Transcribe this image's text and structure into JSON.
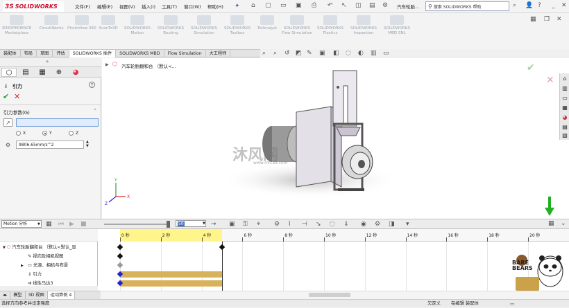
{
  "app": {
    "brand": "SOLIDWORKS",
    "brand_prefix": "3S"
  },
  "menu": [
    "文件(F)",
    "编辑(E)",
    "视图(V)",
    "插入(I)",
    "工具(T)",
    "窗口(W)",
    "帮助(H)"
  ],
  "document_title": "汽车轮胎...",
  "help_search": {
    "placeholder": "搜索 SOLIDWORKS 帮助"
  },
  "command_manager": [
    {
      "label": "3DEXPERIENCE Marketplace"
    },
    {
      "label": "CircuitWorks"
    },
    {
      "label": "PhotoView 360"
    },
    {
      "label": "ScanTo3D"
    },
    {
      "label": "SOLIDWORKS Motion"
    },
    {
      "label": "SOLIDWORKS Routing"
    },
    {
      "label": "SOLIDWORKS Simulation"
    },
    {
      "label": "SOLIDWORKS Toolbox"
    },
    {
      "label": "TolAnalyst"
    },
    {
      "label": "SOLIDWORKS Flow Simulation"
    },
    {
      "label": "SOLIDWORKS Plastics"
    },
    {
      "label": "SOLIDWORKS Inspection"
    },
    {
      "label": "SOLIDWORKS MBD SNL"
    }
  ],
  "command_tabs": [
    "装配体",
    "布局",
    "草图",
    "评估",
    "SOLIDWORKS 插件",
    "SOLIDWORKS MBD",
    "Flow Simulation",
    "大工程师"
  ],
  "active_command_tab": 4,
  "feature_panel": {
    "title": "引力",
    "section": "引力参数(G)",
    "direction_value": "",
    "axes": [
      "X",
      "Y",
      "Z"
    ],
    "selected_axis": "Y",
    "acceleration": "9806.65mm/s^2"
  },
  "graphics": {
    "tree_crumb": "汽车轮胎翻和台 （默认<...",
    "watermark_text": "沐风网",
    "watermark_url": "www.mfcad.com"
  },
  "motion": {
    "study_type": "Motion 分析",
    "zoom_value": "50",
    "tree": [
      {
        "label": "汽车轮胎翻和台 （默认<默认_显"
      },
      {
        "label": "视向及相机视图"
      },
      {
        "label": "光源、相机与布景"
      },
      {
        "label": "引力"
      },
      {
        "label": "线性马达3"
      }
    ],
    "ruler_ticks": [
      "0 秒",
      "2 秒",
      "4 秒",
      "6 秒",
      "8 秒",
      "10 秒",
      "12 秒",
      "14 秒",
      "16 秒",
      "18 秒",
      "20 秒"
    ],
    "highlight_end_seconds": 5
  },
  "bottom_tabs": [
    "模型",
    "3D 视图",
    "运动算例 4"
  ],
  "active_bottom_tab": 2,
  "status": {
    "left": "选择方向参考并设定强度",
    "undefined": "欠定义",
    "mode": "在编辑 装配体"
  },
  "mascot_text": "BARE BEARS",
  "colors": {
    "brand": "#c8102e",
    "timeline_highlight": "#fff58a",
    "bar": "#d8b25a",
    "selection": "#e0ecfb",
    "accept": "#2aa02a",
    "cancel": "#d62b2b"
  }
}
